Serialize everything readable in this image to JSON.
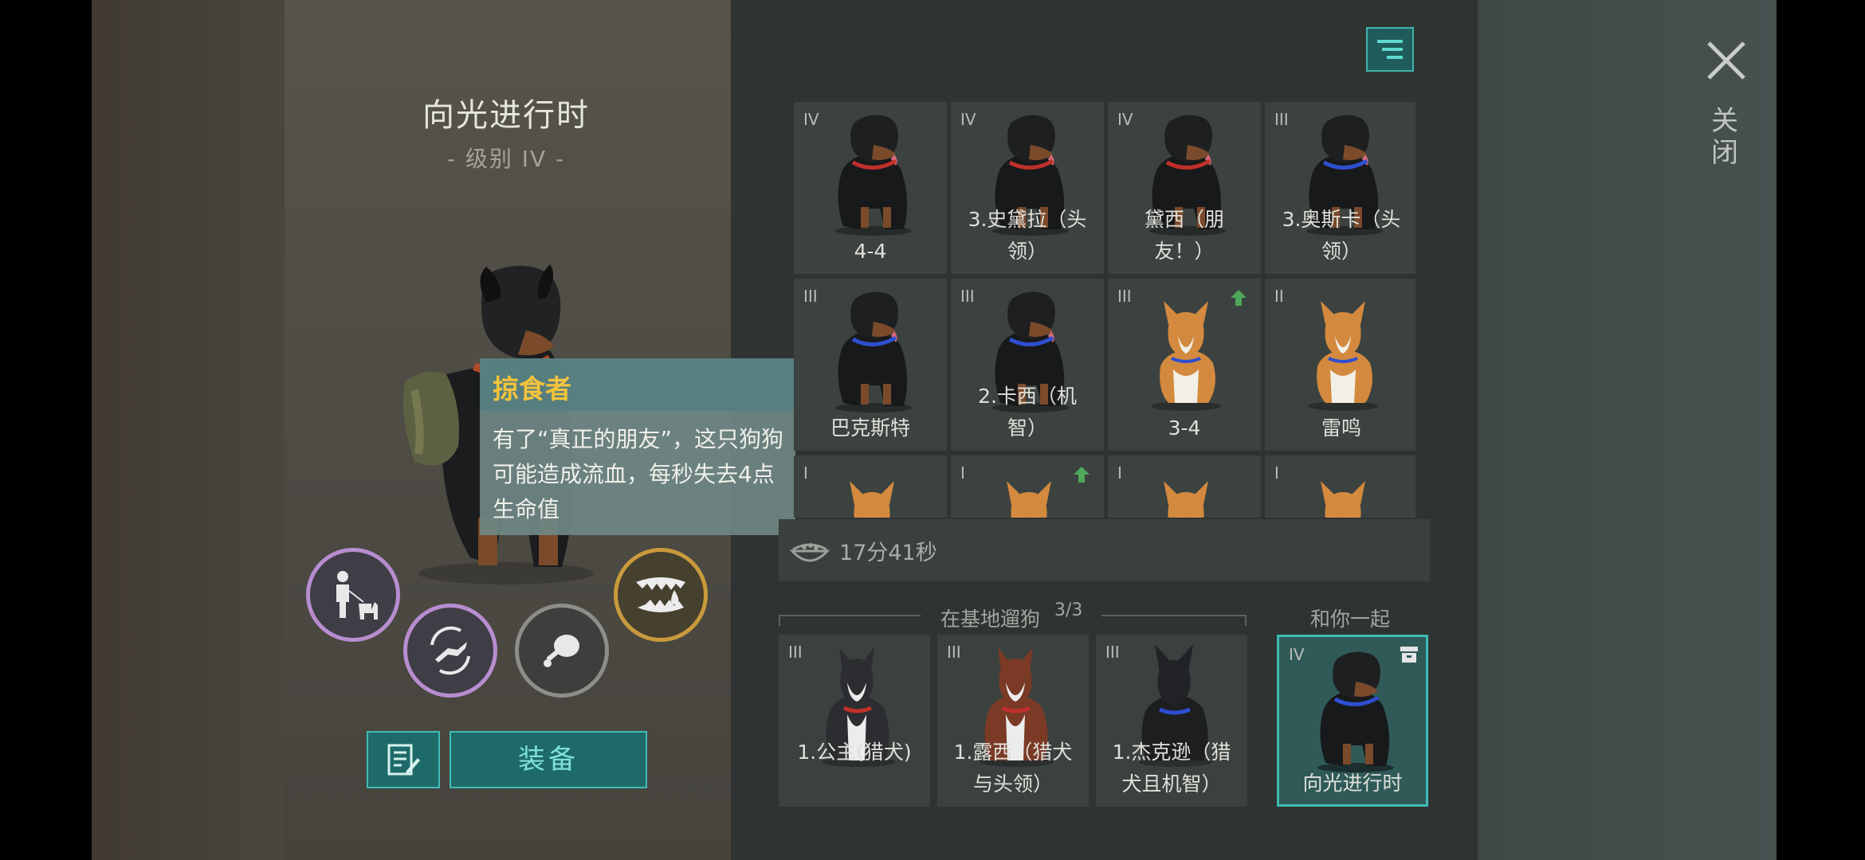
{
  "dog_detail": {
    "name": "向光进行时",
    "level": "- 级别 IV -"
  },
  "tooltip": {
    "title": "掠食者",
    "body": "有了“真正的朋友”，这只狗狗可能造成流血，每秒失去4点生命值"
  },
  "buttons": {
    "equip": "装备",
    "close": "关闭"
  },
  "dog_grid": [
    {
      "tier": "IV",
      "name": "4-4",
      "breed": "rottweiler",
      "upgrade": false
    },
    {
      "tier": "IV",
      "name": "3.史黛拉（头领）",
      "breed": "rottweiler",
      "upgrade": false
    },
    {
      "tier": "IV",
      "name": "黛西（朋友！）",
      "breed": "rottweiler",
      "upgrade": false
    },
    {
      "tier": "III",
      "name": "3.奥斯卡（头领）",
      "breed": "rottweiler",
      "upgrade": false
    },
    {
      "tier": "III",
      "name": "巴克斯特",
      "breed": "rottweiler",
      "upgrade": false
    },
    {
      "tier": "III",
      "name": "2.卡西（机智）",
      "breed": "rottweiler",
      "upgrade": false
    },
    {
      "tier": "III",
      "name": "3-4",
      "breed": "corgi",
      "upgrade": true
    },
    {
      "tier": "II",
      "name": "雷鸣",
      "breed": "corgi",
      "upgrade": false
    },
    {
      "tier": "I",
      "name": "",
      "breed": "corgi",
      "upgrade": false
    },
    {
      "tier": "I",
      "name": "",
      "breed": "corgi",
      "upgrade": true
    },
    {
      "tier": "I",
      "name": "",
      "breed": "corgi",
      "upgrade": false
    },
    {
      "tier": "I",
      "name": "",
      "breed": "corgi",
      "upgrade": false
    }
  ],
  "timer": {
    "text": "17分41秒",
    "icon": "food-bowl-icon"
  },
  "base_walk": {
    "label": "在基地遛狗",
    "count": "3/3",
    "dogs": [
      {
        "tier": "III",
        "name": "1.公主(猎犬)",
        "breed": "husky"
      },
      {
        "tier": "III",
        "name": "1.露西（猎犬与头领）",
        "breed": "husky-red"
      },
      {
        "tier": "III",
        "name": "1.杰克逊（猎犬且机智）",
        "breed": "shepherd"
      }
    ]
  },
  "with_you": {
    "label": "和你一起",
    "dog": {
      "tier": "IV",
      "name": "向光进行时",
      "breed": "rottweiler"
    }
  },
  "skills": [
    {
      "icon": "walk-with-dog-icon",
      "border": "#b78dcf"
    },
    {
      "icon": "dog-jump-cycle-icon",
      "border": "#b78dcf"
    },
    {
      "icon": "meat-icon",
      "border": "#8d8d8a"
    },
    {
      "icon": "fangs-blood-icon",
      "border": "#c99a3c"
    }
  ],
  "colors": {
    "accent": "#3cbbb3",
    "tooltip_title": "#f3c43c",
    "upgrade_green": "#4fa85a"
  }
}
